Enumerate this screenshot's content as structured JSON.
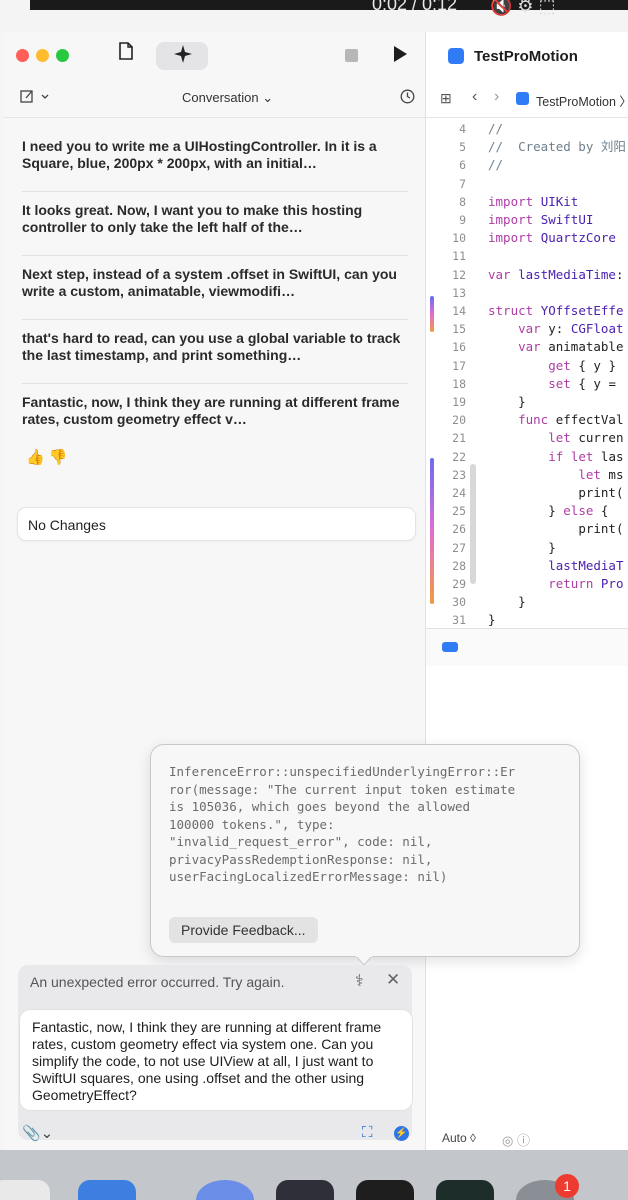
{
  "video": {
    "time": "0:02 / 0:12",
    "icons": "🔇 ⚙ ⬚"
  },
  "left": {
    "toolbar": {
      "conversation_label": "Conversation"
    },
    "messages": [
      {
        "text": "I need you to write me a UIHostingController. In it is a Square, blue, 200px * 200px, with an initial…"
      },
      {
        "text": "It looks great. Now, I want you to make this hosting controller to only take the left half of the…"
      },
      {
        "text": "Next step, instead of a system .offset in SwiftUI, can you write a custom, animatable, viewmodifi…"
      },
      {
        "text": "that's hard to read, can you use a global variable to track the last timestamp, and print something…"
      },
      {
        "text": "Fantastic, now, I think they are running at different frame rates, custom geometry effect v…"
      }
    ],
    "no_changes": "No Changes",
    "error_popover": {
      "message": "InferenceError::unspecifiedUnderlyingError::Er\nror(message: \"The current input token estimate\nis 105036, which goes beyond the allowed\n100000 tokens.\", type:\n\"invalid_request_error\", code: nil,\nprivacyPassRedemptionResponse: nil,\nuserFacingLocalizedErrorMessage: nil)",
      "feedback_button": "Provide Feedback..."
    },
    "error_bar": {
      "text": "An unexpected error occurred. Try again."
    },
    "input": {
      "value": "Fantastic, now, I think they are running at different frame rates, custom geometry effect via system one. Can you simplify the code, to not use UIView at all, I just want to SwiftUI squares, one using .offset and the other using GeometryEffect?"
    }
  },
  "right": {
    "title": "TestProMotion",
    "breadcrumb": "TestProMotion 〉",
    "code_lines": [
      {
        "n": "4",
        "t": "//"
      },
      {
        "n": "5",
        "t": "//  Created by 刘阳"
      },
      {
        "n": "6",
        "t": "//"
      },
      {
        "n": "7",
        "t": ""
      },
      {
        "n": "8",
        "t": "import UIKit"
      },
      {
        "n": "9",
        "t": "import SwiftUI"
      },
      {
        "n": "10",
        "t": "import QuartzCore"
      },
      {
        "n": "11",
        "t": ""
      },
      {
        "n": "12",
        "t": "var lastMediaTime:"
      },
      {
        "n": "13",
        "t": ""
      },
      {
        "n": "14",
        "t": "struct YOffsetEffe"
      },
      {
        "n": "15",
        "t": "    var y: CGFloat"
      },
      {
        "n": "16",
        "t": "    var animatable"
      },
      {
        "n": "17",
        "t": "        get { y }"
      },
      {
        "n": "18",
        "t": "        set { y ="
      },
      {
        "n": "19",
        "t": "    }"
      },
      {
        "n": "20",
        "t": "    func effectVal"
      },
      {
        "n": "21",
        "t": "        let curren"
      },
      {
        "n": "22",
        "t": "        if let las"
      },
      {
        "n": "23",
        "t": "            let ms"
      },
      {
        "n": "24",
        "t": "            print("
      },
      {
        "n": "25",
        "t": "        } else {"
      },
      {
        "n": "26",
        "t": "            print("
      },
      {
        "n": "27",
        "t": "        }"
      },
      {
        "n": "28",
        "t": "        lastMediaT"
      },
      {
        "n": "29",
        "t": "        return Pro"
      },
      {
        "n": "30",
        "t": "    }"
      },
      {
        "n": "31",
        "t": "}"
      }
    ],
    "bottom": {
      "auto": "Auto ◊",
      "icons": "◎  ⓘ"
    }
  },
  "dock": {
    "badge": "1"
  }
}
